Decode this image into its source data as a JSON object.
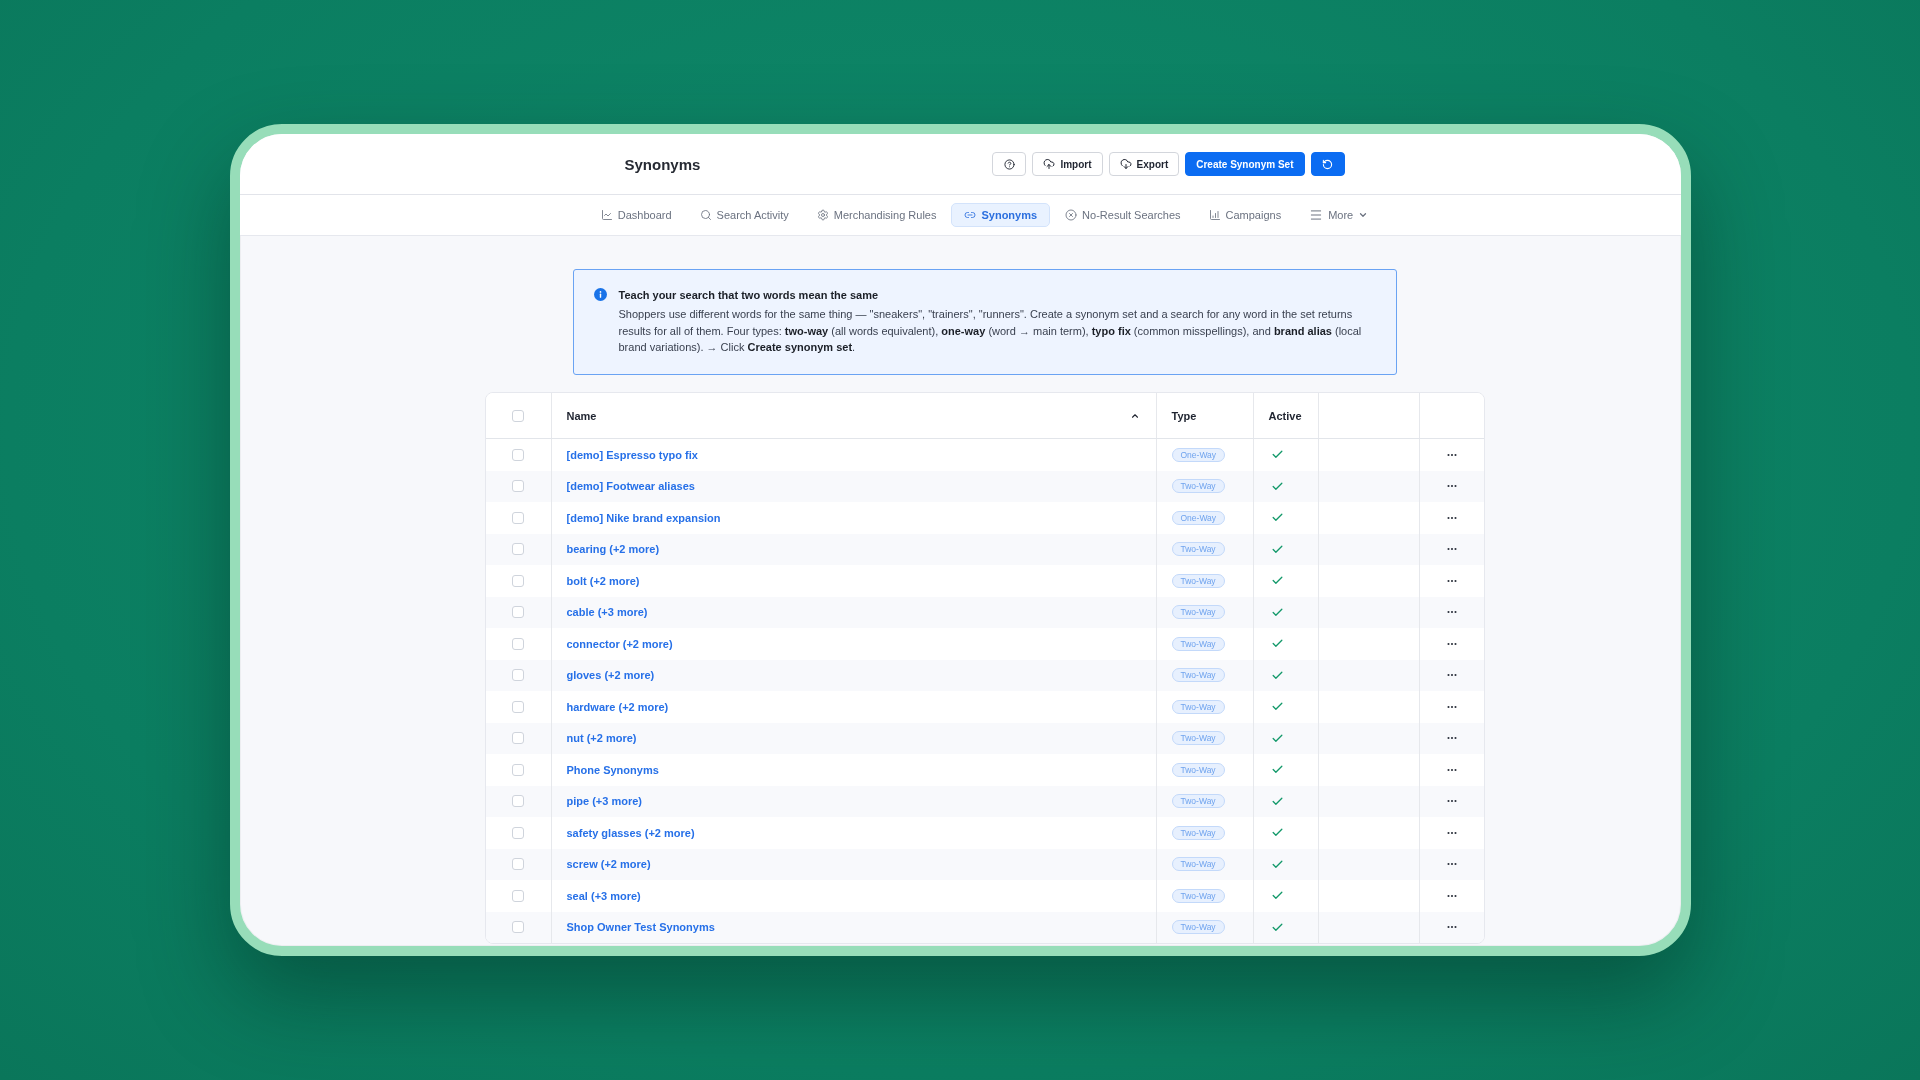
{
  "header": {
    "title": "Synonyms",
    "buttons": [
      {
        "label": "Import",
        "kind": "outline"
      },
      {
        "label": "Export",
        "kind": "outline"
      },
      {
        "label": "Create Synonym Set",
        "kind": "primary"
      }
    ]
  },
  "nav": {
    "items": [
      {
        "label": "Dashboard",
        "selected": false,
        "kind": "link"
      },
      {
        "label": "Search Activity",
        "selected": false,
        "kind": "link"
      },
      {
        "label": "Merchandising Rules",
        "selected": false,
        "kind": "link"
      },
      {
        "label": "Synonyms",
        "selected": true,
        "kind": "link"
      },
      {
        "label": "No-Result Searches",
        "selected": false,
        "kind": "link"
      },
      {
        "label": "Campaigns",
        "selected": false,
        "kind": "link"
      },
      {
        "label": "More",
        "selected": false,
        "kind": "dropdown"
      }
    ]
  },
  "info": {
    "title": "Teach your search that two words mean the same",
    "text": "Shoppers use different words for the same thing — \"sneakers\", \"trainers\", \"runners\". Create a synonym set and a search for any word in the set returns results for all of them. Four types: **two-way** (all words equivalent), **one-way** (word → main term), **typo fix** (common misspellings), and **brand alias** (local brand variations). → Click **Create synonym set**."
  },
  "table": {
    "select_all": {
      "checked": false
    },
    "columns": [
      {
        "label": "Name",
        "sorted": true
      },
      {
        "label": "Type",
        "sorted": false
      },
      {
        "label": "Active",
        "sorted": false
      }
    ],
    "rows": [
      {
        "name": "[demo] Espresso typo fix",
        "type": "One-Way",
        "active": true,
        "checked": false
      },
      {
        "name": "[demo] Footwear aliases",
        "type": "Two-Way",
        "active": true,
        "checked": false
      },
      {
        "name": "[demo] Nike brand expansion",
        "type": "One-Way",
        "active": true,
        "checked": false
      },
      {
        "name": "bearing (+2 more)",
        "type": "Two-Way",
        "active": true,
        "checked": false
      },
      {
        "name": "bolt (+2 more)",
        "type": "Two-Way",
        "active": true,
        "checked": false
      },
      {
        "name": "cable (+3 more)",
        "type": "Two-Way",
        "active": true,
        "checked": false
      },
      {
        "name": "connector (+2 more)",
        "type": "Two-Way",
        "active": true,
        "checked": false
      },
      {
        "name": "gloves (+2 more)",
        "type": "Two-Way",
        "active": true,
        "checked": false
      },
      {
        "name": "hardware (+2 more)",
        "type": "Two-Way",
        "active": true,
        "checked": false
      },
      {
        "name": "nut (+2 more)",
        "type": "Two-Way",
        "active": true,
        "checked": false
      },
      {
        "name": "Phone Synonyms",
        "type": "Two-Way",
        "active": true,
        "checked": false
      },
      {
        "name": "pipe (+3 more)",
        "type": "Two-Way",
        "active": true,
        "checked": false
      },
      {
        "name": "safety glasses (+2 more)",
        "type": "Two-Way",
        "active": true,
        "checked": false
      },
      {
        "name": "screw (+2 more)",
        "type": "Two-Way",
        "active": true,
        "checked": false
      },
      {
        "name": "seal (+3 more)",
        "type": "Two-Way",
        "active": true,
        "checked": false
      },
      {
        "name": "Shop Owner Test Synonyms",
        "type": "Two-Way",
        "active": true,
        "checked": false
      }
    ]
  }
}
